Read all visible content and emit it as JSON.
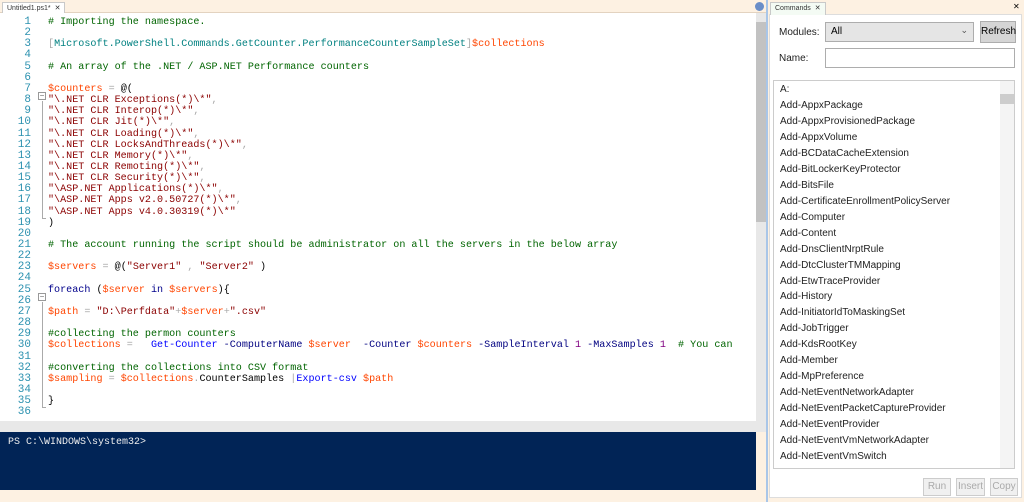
{
  "editor": {
    "tab_label": "Untitled1.ps1*",
    "close_glyph": "✕",
    "lines": [
      [
        [
          "c",
          "# Importing the namespace."
        ]
      ],
      [],
      [
        [
          "o",
          "["
        ],
        [
          "t",
          "Microsoft.PowerShell.Commands.GetCounter.PerformanceCounterSampleSet"
        ],
        [
          "o",
          "]"
        ],
        [
          "v",
          "$collections"
        ]
      ],
      [],
      [
        [
          "c",
          "# An array of the .NET / ASP.NET Performance counters"
        ]
      ],
      [],
      [
        [
          "v",
          "$counters"
        ],
        [
          "o",
          " = "
        ],
        [
          "g",
          "@("
        ]
      ],
      [
        [
          "s",
          "\"\\.NET CLR Exceptions(*)\\*\""
        ],
        [
          "o",
          ","
        ]
      ],
      [
        [
          "s",
          "\"\\.NET CLR Interop(*)\\*\""
        ],
        [
          "o",
          ","
        ]
      ],
      [
        [
          "s",
          "\"\\.NET CLR Jit(*)\\*\""
        ],
        [
          "o",
          ","
        ]
      ],
      [
        [
          "s",
          "\"\\.NET CLR Loading(*)\\*\""
        ],
        [
          "o",
          ","
        ]
      ],
      [
        [
          "s",
          "\"\\.NET CLR LocksAndThreads(*)\\*\""
        ],
        [
          "o",
          ","
        ]
      ],
      [
        [
          "s",
          "\"\\.NET CLR Memory(*)\\*\""
        ],
        [
          "o",
          ","
        ]
      ],
      [
        [
          "s",
          "\"\\.NET CLR Remoting(*)\\*\""
        ],
        [
          "o",
          ","
        ]
      ],
      [
        [
          "s",
          "\"\\.NET CLR Security(*)\\*\""
        ],
        [
          "o",
          ","
        ]
      ],
      [
        [
          "s",
          "\"\\ASP.NET Applications(*)\\*\""
        ],
        [
          "o",
          ","
        ]
      ],
      [
        [
          "s",
          "\"\\ASP.NET Apps v2.0.50727(*)\\*\""
        ],
        [
          "o",
          ","
        ]
      ],
      [
        [
          "s",
          "\"\\ASP.NET Apps v4.0.30319(*)\\*\""
        ]
      ],
      [
        [
          "g",
          ")"
        ]
      ],
      [],
      [
        [
          "c",
          "# The account running the script should be administrator on all the servers in the below array"
        ]
      ],
      [],
      [
        [
          "v",
          "$servers"
        ],
        [
          "o",
          " = "
        ],
        [
          "g",
          "@("
        ],
        [
          "s",
          "\"Server1\""
        ],
        [
          "o",
          " , "
        ],
        [
          "s",
          "\"Server2\""
        ],
        [
          "g",
          " )"
        ]
      ],
      [],
      [
        [
          "k",
          "foreach"
        ],
        [
          "g",
          " ("
        ],
        [
          "v",
          "$server"
        ],
        [
          "k",
          " in "
        ],
        [
          "v",
          "$servers"
        ],
        [
          "g",
          "){"
        ]
      ],
      [],
      [
        [
          "v",
          "$path"
        ],
        [
          "o",
          " = "
        ],
        [
          "s",
          "\"D:\\Perfdata\""
        ],
        [
          "o",
          "+"
        ],
        [
          "v",
          "$server"
        ],
        [
          "o",
          "+"
        ],
        [
          "s",
          "\".csv\""
        ]
      ],
      [],
      [
        [
          "c",
          "#collecting the permon counters"
        ]
      ],
      [
        [
          "v",
          "$collections"
        ],
        [
          "o",
          " =   "
        ],
        [
          "cmd",
          "Get-Counter"
        ],
        [
          "p",
          " -ComputerName"
        ],
        [
          "v",
          " $server"
        ],
        [
          "p",
          "  -Counter"
        ],
        [
          "v",
          " $counters"
        ],
        [
          "p",
          " -SampleInterval"
        ],
        [
          "n",
          " 1"
        ],
        [
          "p",
          " -MaxSamples"
        ],
        [
          "n",
          " 1"
        ],
        [
          "c",
          "  # You can"
        ]
      ],
      [],
      [
        [
          "c",
          "#converting the collections into CSV format"
        ]
      ],
      [
        [
          "v",
          "$sampling"
        ],
        [
          "o",
          " = "
        ],
        [
          "v",
          "$collections"
        ],
        [
          "o",
          "."
        ],
        [
          "m",
          "CounterSamples"
        ],
        [
          "o",
          " |"
        ],
        [
          "cmd",
          "Export-csv"
        ],
        [
          "v",
          " $path"
        ]
      ],
      [],
      [
        [
          "g",
          "}"
        ]
      ],
      []
    ]
  },
  "console": {
    "prompt": "PS C:\\WINDOWS\\system32>"
  },
  "commands": {
    "tab_label": "Commands",
    "close_glyph": "✕",
    "pane_close": "✕",
    "modules_label": "Modules:",
    "modules_value": "All",
    "refresh": "Refresh",
    "name_label": "Name:",
    "name_value": "",
    "items": [
      "A:",
      "Add-AppxPackage",
      "Add-AppxProvisionedPackage",
      "Add-AppxVolume",
      "Add-BCDataCacheExtension",
      "Add-BitLockerKeyProtector",
      "Add-BitsFile",
      "Add-CertificateEnrollmentPolicyServer",
      "Add-Computer",
      "Add-Content",
      "Add-DnsClientNrptRule",
      "Add-DtcClusterTMMapping",
      "Add-EtwTraceProvider",
      "Add-History",
      "Add-InitiatorIdToMaskingSet",
      "Add-JobTrigger",
      "Add-KdsRootKey",
      "Add-Member",
      "Add-MpPreference",
      "Add-NetEventNetworkAdapter",
      "Add-NetEventPacketCaptureProvider",
      "Add-NetEventProvider",
      "Add-NetEventVmNetworkAdapter",
      "Add-NetEventVmSwitch"
    ],
    "run": "Run",
    "insert": "Insert",
    "copy": "Copy"
  },
  "colors": {
    "console_bg": "#012456",
    "comment": "#006400",
    "variable": "#ff4500",
    "string": "#8b0000"
  }
}
